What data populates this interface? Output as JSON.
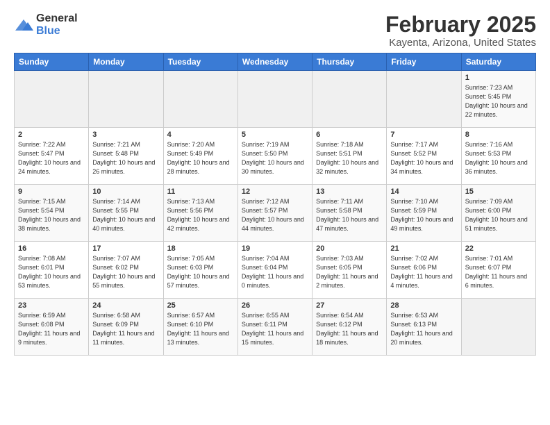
{
  "header": {
    "logo_general": "General",
    "logo_blue": "Blue",
    "month_title": "February 2025",
    "location": "Kayenta, Arizona, United States"
  },
  "weekdays": [
    "Sunday",
    "Monday",
    "Tuesday",
    "Wednesday",
    "Thursday",
    "Friday",
    "Saturday"
  ],
  "weeks": [
    [
      {
        "day": "",
        "info": ""
      },
      {
        "day": "",
        "info": ""
      },
      {
        "day": "",
        "info": ""
      },
      {
        "day": "",
        "info": ""
      },
      {
        "day": "",
        "info": ""
      },
      {
        "day": "",
        "info": ""
      },
      {
        "day": "1",
        "info": "Sunrise: 7:23 AM\nSunset: 5:45 PM\nDaylight: 10 hours and 22 minutes."
      }
    ],
    [
      {
        "day": "2",
        "info": "Sunrise: 7:22 AM\nSunset: 5:47 PM\nDaylight: 10 hours and 24 minutes."
      },
      {
        "day": "3",
        "info": "Sunrise: 7:21 AM\nSunset: 5:48 PM\nDaylight: 10 hours and 26 minutes."
      },
      {
        "day": "4",
        "info": "Sunrise: 7:20 AM\nSunset: 5:49 PM\nDaylight: 10 hours and 28 minutes."
      },
      {
        "day": "5",
        "info": "Sunrise: 7:19 AM\nSunset: 5:50 PM\nDaylight: 10 hours and 30 minutes."
      },
      {
        "day": "6",
        "info": "Sunrise: 7:18 AM\nSunset: 5:51 PM\nDaylight: 10 hours and 32 minutes."
      },
      {
        "day": "7",
        "info": "Sunrise: 7:17 AM\nSunset: 5:52 PM\nDaylight: 10 hours and 34 minutes."
      },
      {
        "day": "8",
        "info": "Sunrise: 7:16 AM\nSunset: 5:53 PM\nDaylight: 10 hours and 36 minutes."
      }
    ],
    [
      {
        "day": "9",
        "info": "Sunrise: 7:15 AM\nSunset: 5:54 PM\nDaylight: 10 hours and 38 minutes."
      },
      {
        "day": "10",
        "info": "Sunrise: 7:14 AM\nSunset: 5:55 PM\nDaylight: 10 hours and 40 minutes."
      },
      {
        "day": "11",
        "info": "Sunrise: 7:13 AM\nSunset: 5:56 PM\nDaylight: 10 hours and 42 minutes."
      },
      {
        "day": "12",
        "info": "Sunrise: 7:12 AM\nSunset: 5:57 PM\nDaylight: 10 hours and 44 minutes."
      },
      {
        "day": "13",
        "info": "Sunrise: 7:11 AM\nSunset: 5:58 PM\nDaylight: 10 hours and 47 minutes."
      },
      {
        "day": "14",
        "info": "Sunrise: 7:10 AM\nSunset: 5:59 PM\nDaylight: 10 hours and 49 minutes."
      },
      {
        "day": "15",
        "info": "Sunrise: 7:09 AM\nSunset: 6:00 PM\nDaylight: 10 hours and 51 minutes."
      }
    ],
    [
      {
        "day": "16",
        "info": "Sunrise: 7:08 AM\nSunset: 6:01 PM\nDaylight: 10 hours and 53 minutes."
      },
      {
        "day": "17",
        "info": "Sunrise: 7:07 AM\nSunset: 6:02 PM\nDaylight: 10 hours and 55 minutes."
      },
      {
        "day": "18",
        "info": "Sunrise: 7:05 AM\nSunset: 6:03 PM\nDaylight: 10 hours and 57 minutes."
      },
      {
        "day": "19",
        "info": "Sunrise: 7:04 AM\nSunset: 6:04 PM\nDaylight: 11 hours and 0 minutes."
      },
      {
        "day": "20",
        "info": "Sunrise: 7:03 AM\nSunset: 6:05 PM\nDaylight: 11 hours and 2 minutes."
      },
      {
        "day": "21",
        "info": "Sunrise: 7:02 AM\nSunset: 6:06 PM\nDaylight: 11 hours and 4 minutes."
      },
      {
        "day": "22",
        "info": "Sunrise: 7:01 AM\nSunset: 6:07 PM\nDaylight: 11 hours and 6 minutes."
      }
    ],
    [
      {
        "day": "23",
        "info": "Sunrise: 6:59 AM\nSunset: 6:08 PM\nDaylight: 11 hours and 9 minutes."
      },
      {
        "day": "24",
        "info": "Sunrise: 6:58 AM\nSunset: 6:09 PM\nDaylight: 11 hours and 11 minutes."
      },
      {
        "day": "25",
        "info": "Sunrise: 6:57 AM\nSunset: 6:10 PM\nDaylight: 11 hours and 13 minutes."
      },
      {
        "day": "26",
        "info": "Sunrise: 6:55 AM\nSunset: 6:11 PM\nDaylight: 11 hours and 15 minutes."
      },
      {
        "day": "27",
        "info": "Sunrise: 6:54 AM\nSunset: 6:12 PM\nDaylight: 11 hours and 18 minutes."
      },
      {
        "day": "28",
        "info": "Sunrise: 6:53 AM\nSunset: 6:13 PM\nDaylight: 11 hours and 20 minutes."
      },
      {
        "day": "",
        "info": ""
      }
    ]
  ]
}
